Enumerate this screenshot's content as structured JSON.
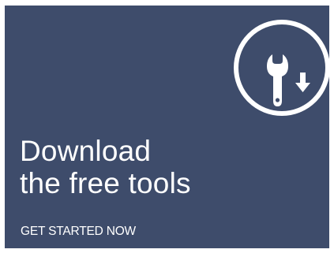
{
  "promo": {
    "headline_line1": "Download",
    "headline_line2": "the free tools",
    "cta_label": "GET STARTED NOW",
    "icon": "wrench-download-icon",
    "background_color": "#3e4c6b",
    "text_color": "#ffffff"
  }
}
